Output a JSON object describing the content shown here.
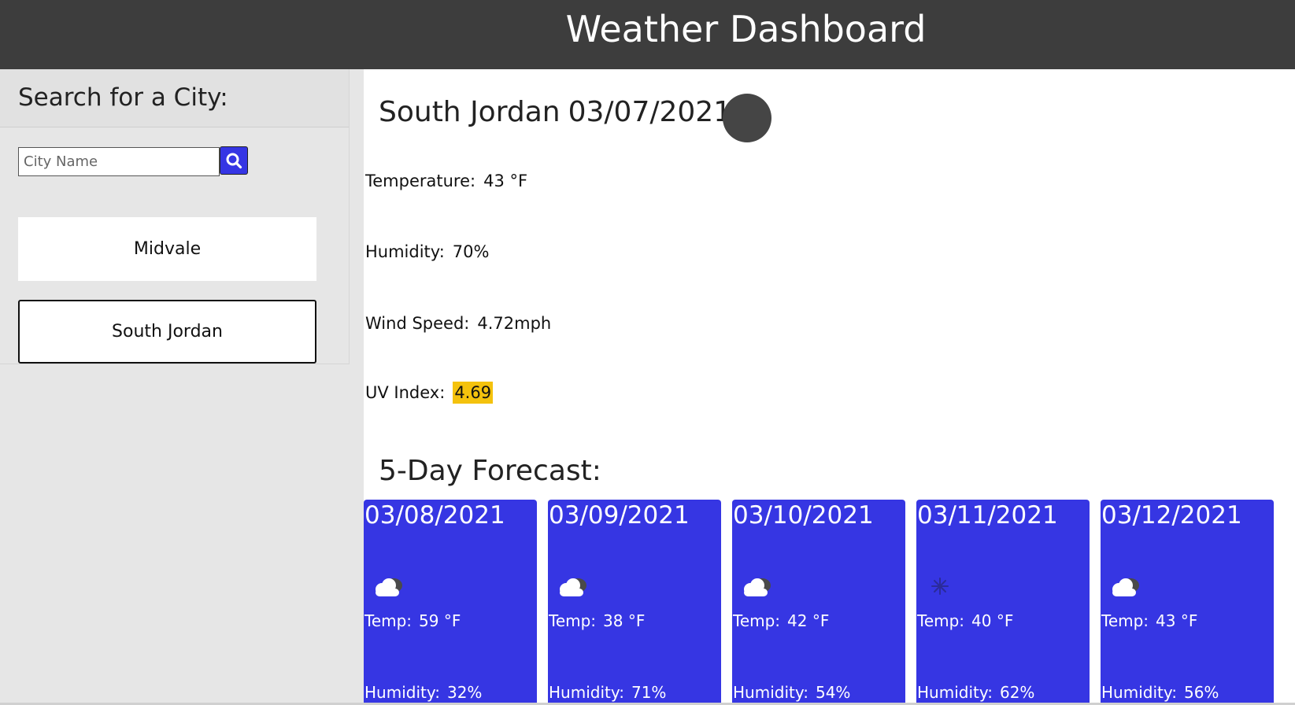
{
  "header": {
    "title": "Weather Dashboard"
  },
  "sidebar": {
    "heading": "Search for a City:",
    "search": {
      "placeholder": "City Name",
      "value": ""
    },
    "search_button_icon": "search-icon",
    "cities": [
      "Midvale",
      "South Jordan"
    ]
  },
  "current": {
    "city": "South Jordan",
    "date": "03/07/2021",
    "icon": "moon-icon",
    "temperature_label": "Temperature:",
    "temperature": "43 °F",
    "humidity_label": "Humidity:",
    "humidity": "70%",
    "wind_label": "Wind Speed:",
    "wind": "4.72mph",
    "uv_label": "UV Index:",
    "uv": "4.69"
  },
  "forecast": {
    "title": "5-Day Forecast:",
    "temp_label": "Temp:",
    "humidity_label": "Humidity:",
    "days": [
      {
        "date": "03/08/2021",
        "icon": "cloud-icon",
        "temp": "59 °F",
        "humidity": "32%"
      },
      {
        "date": "03/09/2021",
        "icon": "cloud-icon",
        "temp": "38 °F",
        "humidity": "71%"
      },
      {
        "date": "03/10/2021",
        "icon": "cloud-icon",
        "temp": "42 °F",
        "humidity": "54%"
      },
      {
        "date": "03/11/2021",
        "icon": "snowflake-icon",
        "temp": "40 °F",
        "humidity": "62%"
      },
      {
        "date": "03/12/2021",
        "icon": "cloud-icon",
        "temp": "43 °F",
        "humidity": "56%"
      }
    ]
  },
  "colors": {
    "header_bg": "#3d3d3d",
    "accent": "#3636e3",
    "uv_badge": "#f4c20d",
    "sidebar_bg": "#e6e6e6"
  }
}
